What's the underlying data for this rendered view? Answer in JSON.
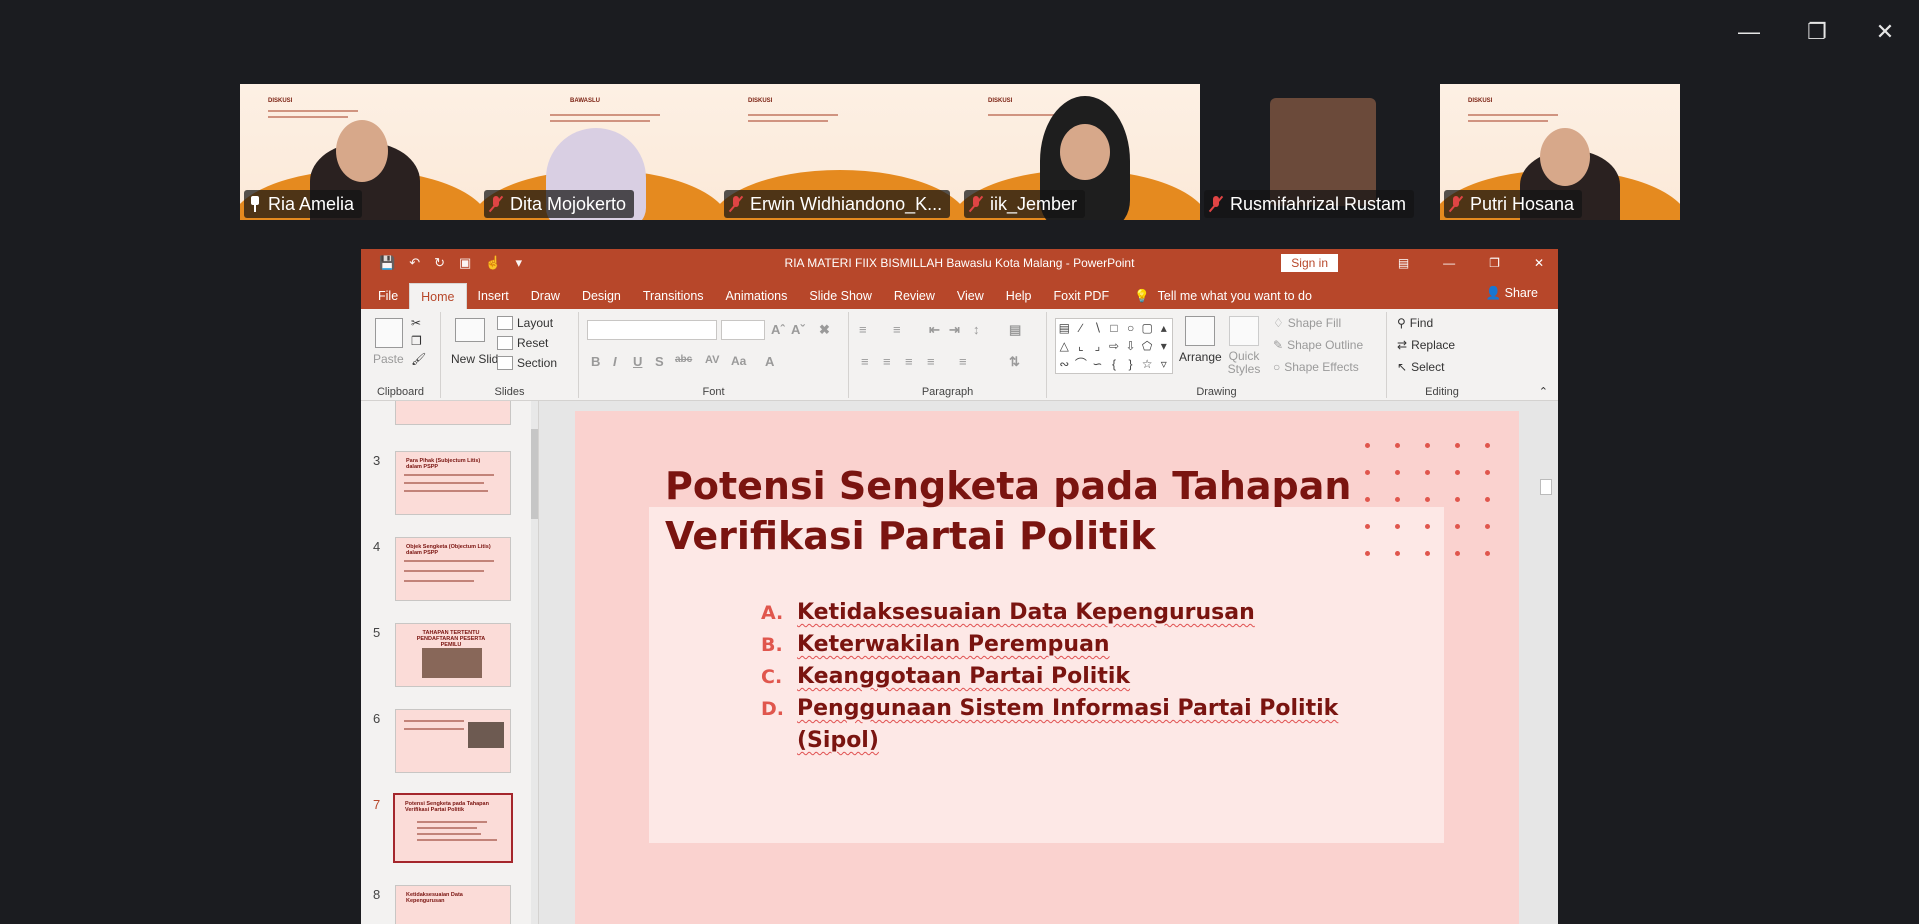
{
  "window": {
    "controls": [
      "minimize",
      "restore",
      "close"
    ]
  },
  "participants": [
    {
      "name": "Ria Amelia",
      "muted": false,
      "pinned": true,
      "active": true
    },
    {
      "name": "Dita Mojokerto",
      "muted": true
    },
    {
      "name": "Erwin Widhiandono_K...",
      "muted": true
    },
    {
      "name": "iik_Jember",
      "muted": true
    },
    {
      "name": "Rusmifahrizal Rustam",
      "muted": true
    },
    {
      "name": "Putri Hosana",
      "muted": true
    }
  ],
  "banner": {
    "heading": "DISKUSI",
    "org": "BAWASLU"
  },
  "powerpoint": {
    "doc_title": "RIA MATERI FIIX BISMILLAH Bawaslu Kota Malang  -  PowerPoint",
    "sign_in": "Sign in",
    "share": "Share",
    "tabs": [
      "File",
      "Home",
      "Insert",
      "Draw",
      "Design",
      "Transitions",
      "Animations",
      "Slide Show",
      "Review",
      "View",
      "Help",
      "Foxit PDF"
    ],
    "active_tab": "Home",
    "tell_me": "Tell me what you want to do",
    "ribbon": {
      "clipboard": {
        "label": "Clipboard",
        "paste": "Paste"
      },
      "slides": {
        "label": "Slides",
        "new_slide": "New Slide",
        "layout": "Layout",
        "reset": "Reset",
        "section": "Section"
      },
      "font": {
        "label": "Font",
        "buttons": [
          "B",
          "I",
          "U",
          "S",
          "abc",
          "AV",
          "Aa",
          "A"
        ]
      },
      "paragraph": {
        "label": "Paragraph"
      },
      "drawing": {
        "label": "Drawing",
        "arrange": "Arrange",
        "quick_styles": "Quick Styles",
        "shape_fill": "Shape Fill",
        "shape_outline": "Shape Outline",
        "shape_effects": "Shape Effects"
      },
      "editing": {
        "label": "Editing",
        "find": "Find",
        "replace": "Replace",
        "select": "Select"
      }
    },
    "thumbnails": [
      {
        "num": "3",
        "title": "Para Pihak (Subjectum Litis) dalam PSPP"
      },
      {
        "num": "4",
        "title": "Objek Sengketa (Objectum Litis) dalam PSPP"
      },
      {
        "num": "5",
        "title": "TAHAPAN TERTENTU PENDAFTARAN PESERTA PEMILU"
      },
      {
        "num": "6",
        "title": ""
      },
      {
        "num": "7",
        "title": "Potensi Sengketa pada Tahapan Verifikasi Partai Politik",
        "active": true
      },
      {
        "num": "8",
        "title": "Ketidaksesuaian Data Kepengurusan"
      }
    ],
    "slide": {
      "title": "Potensi Sengketa pada Tahapan Verifikasi Partai Politik",
      "bullets": [
        {
          "letter": "A.",
          "text": "Ketidaksesuaian Data Kepengurusan"
        },
        {
          "letter": "B.",
          "text": "Keterwakilan Perempuan"
        },
        {
          "letter": "C.",
          "text": "Keanggotaan Partai Politik"
        },
        {
          "letter": "D.",
          "text": "Penggunaan Sistem Informasi Partai Politik (Sipol)"
        }
      ]
    }
  },
  "colors": {
    "ppt_accent": "#b7472a",
    "slide_bg": "#fad2cf",
    "title_color": "#7a1410",
    "bullet_letter": "#e0564d",
    "active_speaker": "#2ed573"
  }
}
